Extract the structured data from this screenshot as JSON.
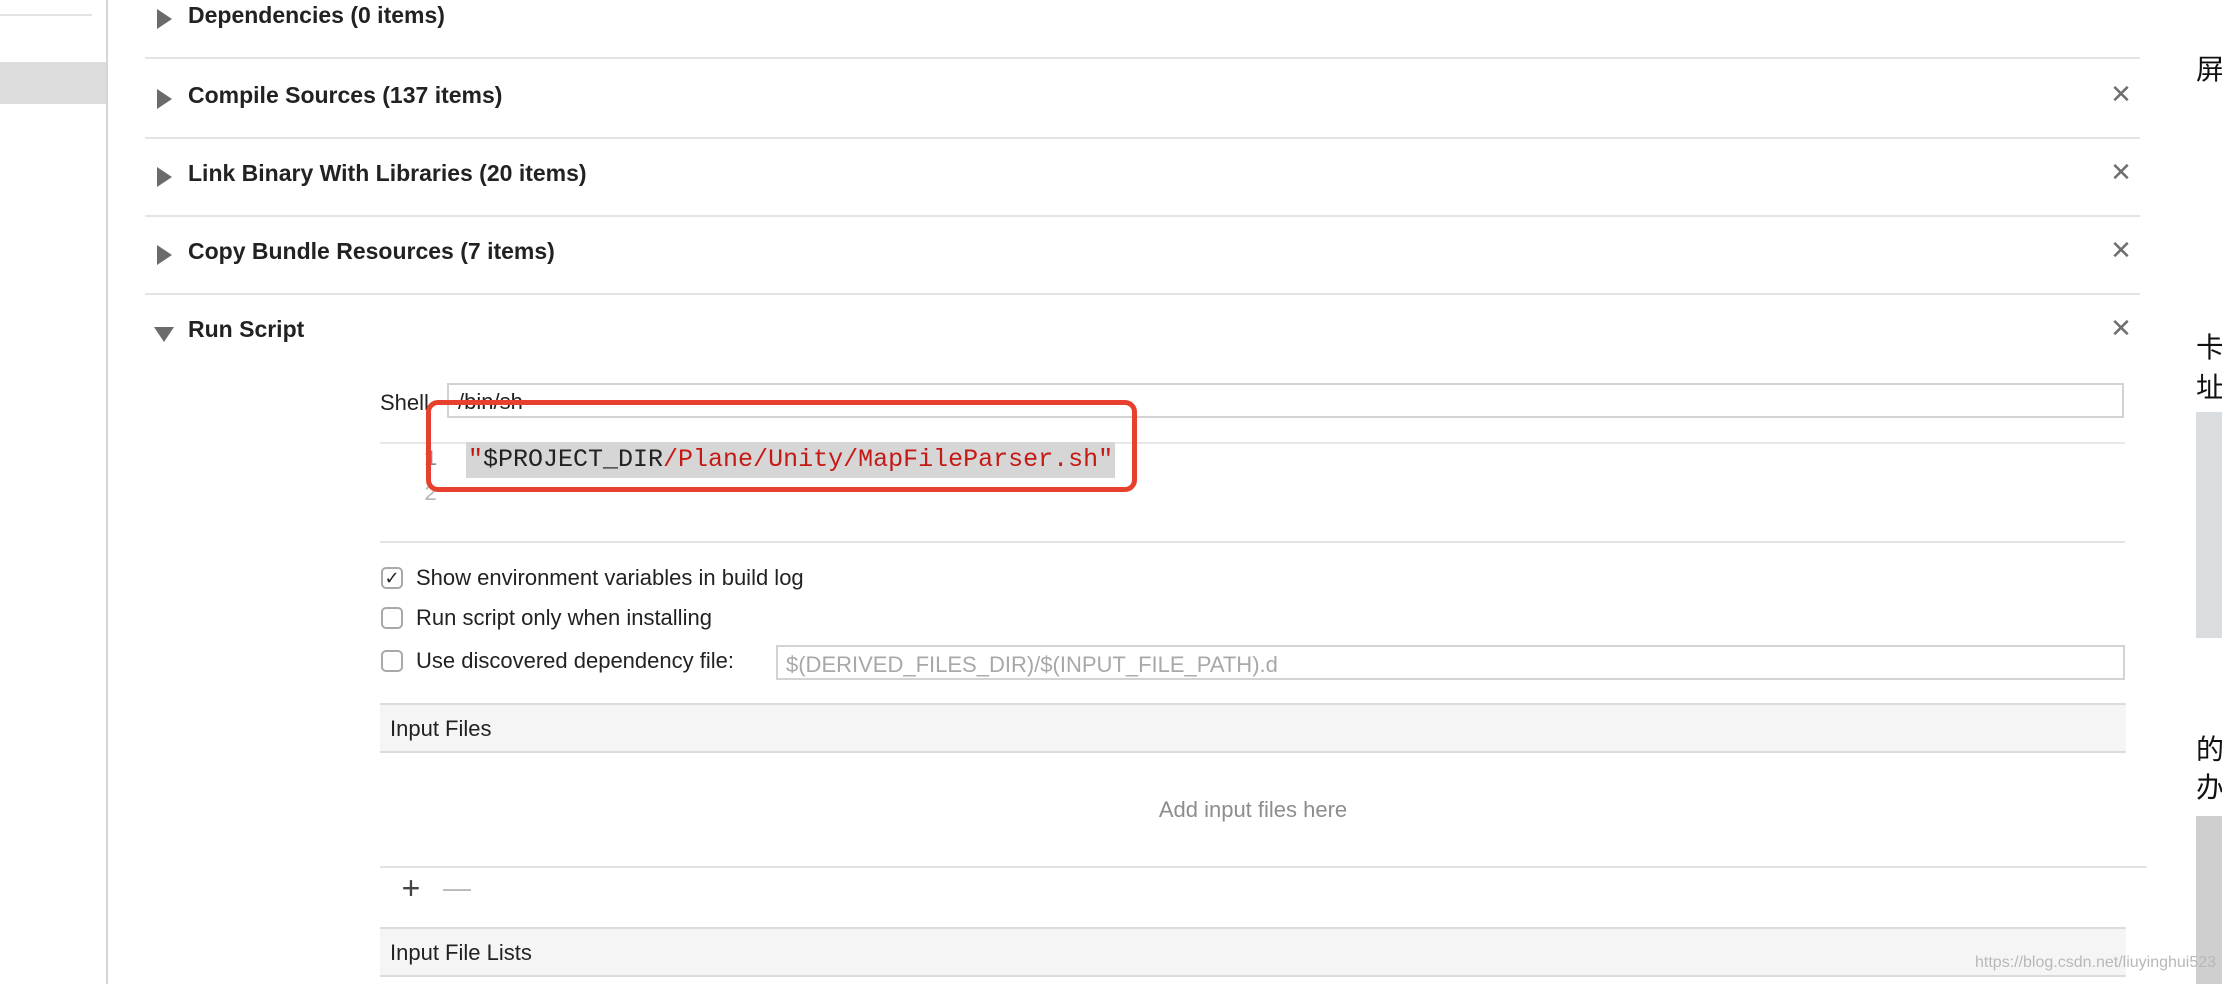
{
  "build_phases": [
    {
      "title": "Dependencies (0 items)",
      "expanded": false,
      "removable": false
    },
    {
      "title": "Compile Sources (137 items)",
      "expanded": false,
      "removable": true
    },
    {
      "title": "Link Binary With Libraries (20 items)",
      "expanded": false,
      "removable": true
    },
    {
      "title": "Copy Bundle Resources (7 items)",
      "expanded": false,
      "removable": true
    },
    {
      "title": "Run Script",
      "expanded": true,
      "removable": true
    }
  ],
  "close_glyph": "✕",
  "run_script": {
    "shell_label": "Shell",
    "shell_value": "/bin/sh",
    "line_numbers": [
      "1",
      "2"
    ],
    "script": {
      "quote_open": "\"",
      "variable": "$PROJECT_DIR",
      "path": "/Plane/Unity/MapFileParser.sh",
      "quote_close": "\""
    },
    "options": [
      {
        "label": "Show environment variables in build log",
        "checked": true
      },
      {
        "label": "Run script only when installing",
        "checked": false
      },
      {
        "label": "Use discovered dependency file:",
        "checked": false
      }
    ],
    "dependency_file_placeholder": "$(DERIVED_FILES_DIR)/$(INPUT_FILE_PATH).d",
    "input_files": {
      "header": "Input Files",
      "empty_placeholder": "Add input files here",
      "add_glyph": "+",
      "remove_glyph": "—"
    },
    "input_file_lists": {
      "header": "Input File Lists"
    }
  },
  "right_gutter_chars": [
    "屏",
    "卡",
    "址",
    "的",
    "办"
  ],
  "watermark": "https://blog.csdn.net/liuyinghui523",
  "colors": {
    "highlight_box": "#e8402e",
    "string": "#c41a16",
    "selection": "#d6d6d6"
  }
}
